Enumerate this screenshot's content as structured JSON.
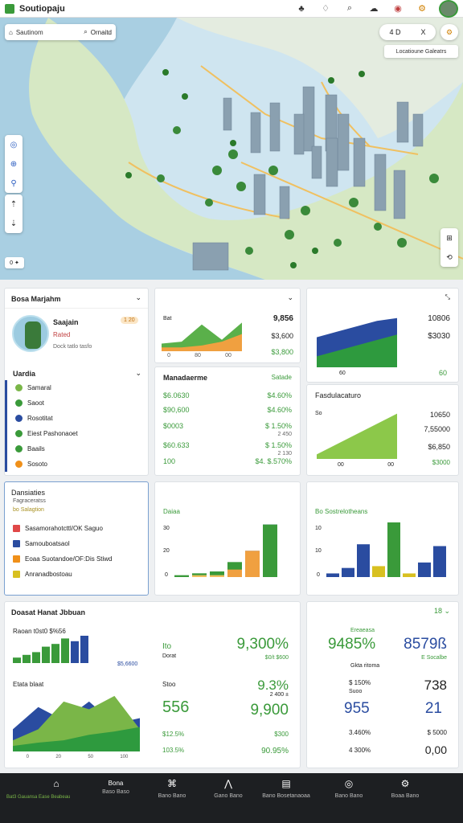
{
  "app": {
    "title": "Soutiopaju"
  },
  "topbar": {
    "icons": [
      "tree-icon",
      "bell-icon",
      "search-icon",
      "cloud-icon",
      "layers-icon",
      "settings-icon"
    ]
  },
  "map": {
    "search": {
      "value": "Sautinom",
      "action": "Ornaitd"
    },
    "right_controls": [
      "4 D",
      "X"
    ],
    "banner": "Locatioune Galeatrs",
    "scale": "0 ✦"
  },
  "card_profile": {
    "title": "Bosa Marjahm",
    "name": "Saajain",
    "badge": "1 20",
    "tag": "Rated",
    "meta": "Dock tatlo tasfo",
    "section": "Uardia",
    "items": [
      {
        "label": "Samaral",
        "color": "#7ab648"
      },
      {
        "label": "Saoot",
        "color": "#3a9a3a"
      },
      {
        "label": "Rosotitat",
        "color": "#2a4ca0"
      },
      {
        "label": "Eiest Pashonaoet",
        "color": "#3a9a3a"
      },
      {
        "label": "Baails",
        "color": "#3a9a3a"
      },
      {
        "label": "Sosoto",
        "color": "#f0901a"
      }
    ]
  },
  "card_area1": {
    "label": "Bat",
    "value": "9,856",
    "sub1": "$3,600",
    "sub2": "$3,800",
    "ticks": [
      "0",
      "80",
      "00"
    ],
    "chart_data": {
      "type": "area",
      "series": [
        {
          "values": [
            8,
            10,
            28,
            12,
            30
          ]
        },
        {
          "values": [
            4,
            4,
            6,
            10,
            18
          ]
        }
      ]
    }
  },
  "card_metrics": {
    "title": "Manadaerme",
    "right": "Satade",
    "rows": [
      {
        "left": "$6.0630",
        "right": "$4.60%"
      },
      {
        "left": "$90,600",
        "right": "$4.60%"
      },
      {
        "left": "$0003",
        "right": "$ 1.50%",
        "sub": "2 450"
      },
      {
        "left": "$60.633",
        "right": "$ 1.50%",
        "sub": "2 130"
      },
      {
        "left": "100",
        "right": "$4. $.570%"
      }
    ]
  },
  "card_area2": {
    "value": "10806",
    "sub1": "$3030",
    "tick": "60",
    "chart_data": {
      "type": "area",
      "series": [
        {
          "values": [
            22,
            26,
            30,
            34,
            36
          ]
        },
        {
          "values": [
            8,
            12,
            16,
            20,
            24
          ]
        }
      ]
    }
  },
  "card_area3": {
    "title": "Fasdulacaturo",
    "label": "So",
    "value": "10650",
    "sub1": "7,55000",
    "sub2": "$6,850",
    "sub3": "$3000",
    "ticks": [
      "00",
      "00"
    ],
    "chart_data": {
      "type": "area",
      "values": [
        4,
        40
      ]
    }
  },
  "card_list": {
    "title": "Dansiaties",
    "subtitle": "Fagraceratss",
    "note": "bo Salagtion",
    "items": [
      {
        "label": "Sasamorahotcttl/OK Saguo",
        "color": "#e04848"
      },
      {
        "label": "Samouboatsaol",
        "color": "#2a4ca0"
      },
      {
        "label": "Eoaa Suotandoe/OF:Dis Stiwd",
        "color": "#f0901a"
      },
      {
        "label": "Anranadbostoau",
        "color": "#d8c020"
      }
    ]
  },
  "card_bar1": {
    "title": "Daiaa",
    "yticks": [
      "30",
      "20",
      "0"
    ],
    "chart_data": {
      "type": "bar",
      "series": [
        {
          "values": [
            1,
            2,
            3,
            8,
            14,
            28
          ]
        },
        {
          "values": [
            0,
            1,
            1,
            4,
            14,
            20
          ]
        }
      ]
    }
  },
  "card_bar2": {
    "title": "Bo Sostrelotheans",
    "yticks": [
      "10",
      "10",
      "0"
    ],
    "chart_data": {
      "type": "bar",
      "values": [
        2,
        5,
        18,
        6,
        30,
        2,
        8,
        17
      ]
    }
  },
  "card_summary": {
    "title": "Doasat Hanat Jbbuan",
    "kpi": "Raoan t0st0 $%56",
    "small_link": "$5,6600",
    "label_section": "Etata blaat",
    "ticks": [
      "0",
      "20",
      "50",
      "100"
    ],
    "bar_chart": {
      "type": "bar",
      "values": [
        2,
        3,
        4,
        6,
        7,
        9,
        8,
        10
      ]
    },
    "area_chart": {
      "type": "area",
      "series": [
        {
          "values": [
            20,
            40,
            28,
            45,
            25,
            30
          ]
        },
        {
          "values": [
            10,
            20,
            45,
            38,
            50,
            20
          ]
        },
        {
          "values": [
            5,
            8,
            10,
            15,
            18,
            22
          ]
        }
      ]
    },
    "left_values": {
      "a": "Ito",
      "b": "Dorat",
      "c": "Stoo",
      "d": "556",
      "e": "$12.5%",
      "f": "103.5%"
    },
    "right_values": {
      "a": "9,300%",
      "b": "$0/t $600",
      "c": "9.3%",
      "d": "2 400 ±",
      "e": "9,900",
      "f": "$300",
      "g": "90.95%"
    }
  },
  "card_kpi": {
    "dropdown": "18",
    "top_label": "Ereaeasa",
    "v1": "9485%",
    "v2": "8579ß",
    "s1": "Gkta ritoma",
    "s2": "E Socalbe",
    "m1": "$ 150%",
    "m2": "Suoo",
    "m3": "$ 150%",
    "m4": "738",
    "v3": "955",
    "v4": "21",
    "w1": "3.460%",
    "w2": "$ 5000",
    "x1": "4 300%",
    "x2": "0,00"
  },
  "nav": {
    "status": "Bat3 Gauansa Ease Beabeau",
    "items": [
      {
        "label": "Bona",
        "sub": "Baso  Baso",
        "icon": "home-icon"
      },
      {
        "label": "Baoa",
        "sub": "Bano  Bano",
        "icon": "grid-icon"
      },
      {
        "label": "Bnas",
        "sub": "Gano  Bano",
        "icon": "chart-icon"
      },
      {
        "label": "Baonanaoa",
        "sub": "Bano  Bosetanaoaa",
        "icon": "doc-icon"
      },
      {
        "label": "Baoa",
        "sub": "Bano  Bano",
        "icon": "user-icon"
      },
      {
        "label": "Boas",
        "sub": "Boaa  Bano",
        "icon": "settings-icon"
      }
    ]
  }
}
